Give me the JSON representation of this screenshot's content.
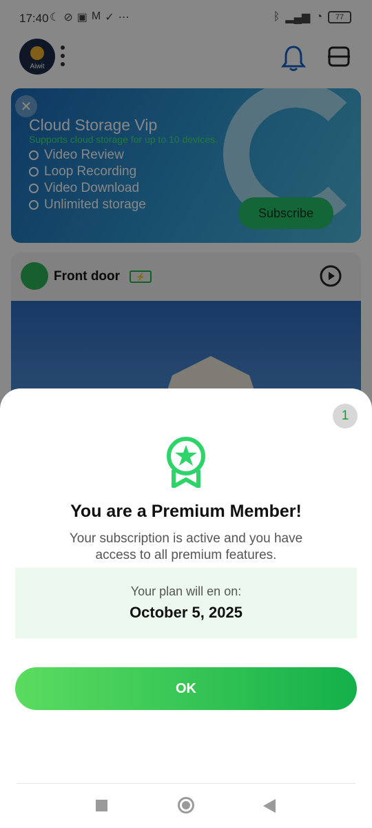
{
  "status_bar": {
    "time": "17:40",
    "battery": "77",
    "left_icons": [
      "moon-icon",
      "mute-icon",
      "message-icon",
      "gmail-icon",
      "check-icon",
      "more-icon"
    ],
    "right_icons": [
      "bluetooth-icon",
      "signal-icon",
      "wifi-icon"
    ]
  },
  "header": {
    "logo_text": "Aiwit"
  },
  "promo": {
    "title": "Cloud Storage Vip",
    "subtitle": "Supports cloud storage for up to 10 devices.",
    "features": [
      "Video Review",
      "Loop Recording",
      "Video Download",
      "Unlimited storage"
    ],
    "subscribe_label": "Subscribe"
  },
  "device": {
    "name": "Front door"
  },
  "modal": {
    "counter": "1",
    "title": "You are a Premium Member!",
    "description": "Your subscription is active and you have access to all premium features.",
    "plan_label": "Your plan will en on:",
    "plan_date": "October 5, 2025",
    "ok_label": "OK"
  },
  "colors": {
    "accent": "#14b04a",
    "overlay": "#00000078"
  }
}
